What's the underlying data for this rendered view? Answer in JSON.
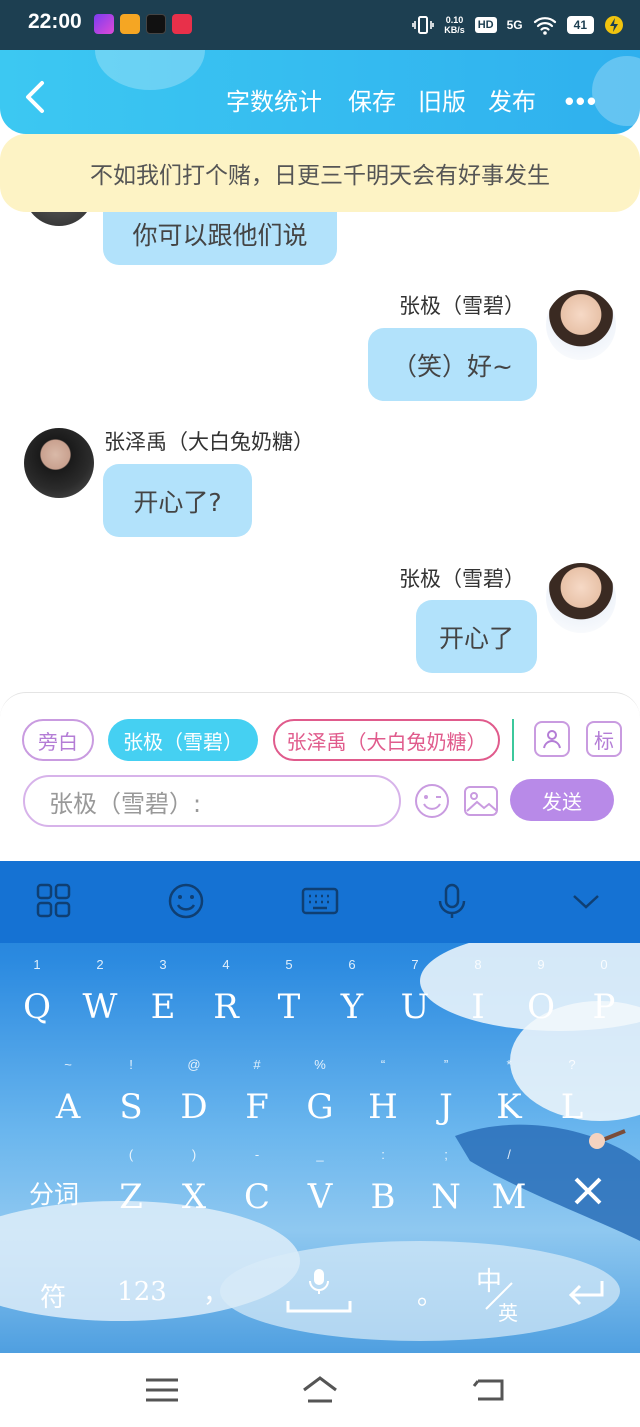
{
  "status_bar": {
    "time": "22:00",
    "net_speed_value": "0.10",
    "net_speed_unit": "KB/s",
    "hd": "HD",
    "network": "5G",
    "battery": "41"
  },
  "header": {
    "actions": [
      "字数统计",
      "保存",
      "旧版",
      "发布"
    ],
    "more": "•••"
  },
  "notice": "不如我们打个赌，日更三千明天会有好事发生",
  "messages": [
    {
      "side": "left",
      "text": "你可以跟他们说"
    },
    {
      "side": "right",
      "name": "张极（雪碧）",
      "text": "（笑）好~"
    },
    {
      "side": "left",
      "name": "张泽禹（大白兔奶糖）",
      "text": "开心了?"
    },
    {
      "side": "right",
      "name": "张极（雪碧）",
      "text": "开心了"
    }
  ],
  "roles": {
    "narration": "旁白",
    "role1": "张极（雪碧）",
    "role2": "张泽禹（大白兔奶糖）",
    "tag_button": "标"
  },
  "input": {
    "placeholder": "张极（雪碧）:",
    "send": "发送"
  },
  "keyboard": {
    "row1": [
      [
        "Q",
        "1"
      ],
      [
        "W",
        "2"
      ],
      [
        "E",
        "3"
      ],
      [
        "R",
        "4"
      ],
      [
        "T",
        "5"
      ],
      [
        "Y",
        "6"
      ],
      [
        "U",
        "7"
      ],
      [
        "I",
        "8"
      ],
      [
        "O",
        "9"
      ],
      [
        "P",
        "0"
      ]
    ],
    "row2": [
      [
        "A",
        "~"
      ],
      [
        "S",
        "!"
      ],
      [
        "D",
        "@"
      ],
      [
        "F",
        "#"
      ],
      [
        "G",
        "%"
      ],
      [
        "H",
        "“"
      ],
      [
        "J",
        "”"
      ],
      [
        "K",
        "*"
      ],
      [
        "L",
        "?"
      ]
    ],
    "row3": [
      [
        "Z",
        "("
      ],
      [
        "X",
        ")"
      ],
      [
        "C",
        "-"
      ],
      [
        "V",
        "_"
      ],
      [
        "B",
        ":"
      ],
      [
        "N",
        ";"
      ],
      [
        "M",
        "/"
      ]
    ],
    "segment": "分词",
    "symbols": "符",
    "numbers": "123",
    "comma": "，",
    "period": "。",
    "lang_primary": "中",
    "lang_secondary": "英"
  },
  "colors": {
    "header": "#3cc8f2",
    "bubble": "#b2e2fb",
    "notice_bg": "#fdf3c5",
    "active_chip": "#45d0f2",
    "purple": "#b88ae8",
    "role2_border": "#e05b8c"
  }
}
